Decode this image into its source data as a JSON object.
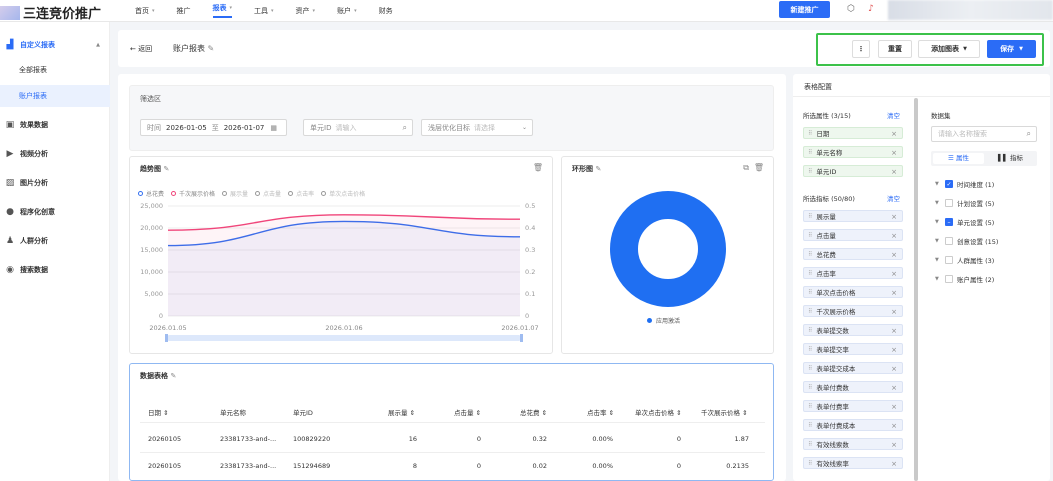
{
  "app": {
    "logo_text": "三连竞价推广"
  },
  "nav": {
    "items": [
      {
        "label": "首页",
        "caret": "▾"
      },
      {
        "label": "推广",
        "caret": ""
      },
      {
        "label": "报表",
        "caret": "▾"
      },
      {
        "label": "工具",
        "caret": "▾"
      },
      {
        "label": "资产",
        "caret": "▾"
      },
      {
        "label": "账户",
        "caret": "▾"
      },
      {
        "label": "财务",
        "caret": ""
      }
    ],
    "new_button": "新建推广"
  },
  "sidebar": {
    "group_custom": "自定义报表",
    "sub_items": [
      "全部报表",
      "账户报表"
    ],
    "items": [
      "效果数据",
      "视频分析",
      "图片分析",
      "程序化创意",
      "人群分析",
      "搜索数据"
    ]
  },
  "header": {
    "back_label": "← 返回",
    "title": "账户报表",
    "more": "⋮",
    "reset": "重置",
    "add_chart": "添加图表",
    "save": "保存"
  },
  "filter": {
    "title": "筛选区",
    "time_label": "时间",
    "date_start": "2026-01-05",
    "date_sep": "至",
    "date_end": "2026-01-07",
    "unit_id_label": "单元ID",
    "unit_id_placeholder": "请输入",
    "opt_target_label": "浅层优化目标",
    "opt_target_placeholder": "请选择"
  },
  "line_chart": {
    "title": "趋势图",
    "legend": [
      "总花费",
      "千次展示价格",
      "展示量",
      "点击量",
      "点击率",
      "单次点击价格"
    ],
    "y_left_ticks": [
      "25,000",
      "20,000",
      "15,000",
      "10,000",
      "5,000",
      "0"
    ],
    "y_right_ticks": [
      "0.5",
      "0.4",
      "0.3",
      "0.2",
      "0.1",
      "0"
    ],
    "x_ticks": [
      "2026.01.05",
      "2026.01.06",
      "2026.01.07"
    ],
    "colors": {
      "spend": "#3370f0",
      "cpm": "#f0457a"
    }
  },
  "chart_data": [
    {
      "type": "line",
      "title": "趋势图",
      "categories": [
        "2026.01.05",
        "2026.01.06",
        "2026.01.07"
      ],
      "series": [
        {
          "name": "总花费",
          "axis": "left",
          "values": [
            16000,
            21500,
            18000
          ]
        },
        {
          "name": "千次展示价格",
          "axis": "right",
          "values": [
            0.39,
            0.46,
            0.44
          ]
        }
      ],
      "ylim_left": [
        0,
        25000
      ],
      "ylim_right": [
        0,
        0.5
      ],
      "grid": true,
      "legend": "top-left"
    },
    {
      "type": "pie",
      "title": "环形图",
      "categories": [
        "应用激活"
      ],
      "values": [
        100
      ]
    }
  ],
  "donut_chart": {
    "title": "环形图",
    "legend_label": "应用激活",
    "color": "#1f6ff2"
  },
  "table": {
    "title": "数据表格",
    "headers": [
      "日期 ⇕",
      "单元名称",
      "单元ID",
      "展示量 ⇕",
      "点击量 ⇕",
      "总花费 ⇕",
      "点击率 ⇕",
      "单次点击价格 ⇕",
      "千次展示价格 ⇕"
    ],
    "rows": [
      [
        "20260105",
        "23381733-and-...",
        "100829220",
        "16",
        "0",
        "0.32",
        "0.00%",
        "0",
        "1.87"
      ],
      [
        "20260105",
        "23381733-and-...",
        "151294689",
        "8",
        "0",
        "0.02",
        "0.00%",
        "0",
        "0.2135"
      ]
    ]
  },
  "config_panel": {
    "title": "表格配置",
    "selected_attrs_label": "所选属性 (3/15)",
    "clear": "清空",
    "selected_attrs": [
      "日期",
      "单元名称",
      "单元ID"
    ],
    "selected_metrics_label": "所选指标 (50/80)",
    "selected_metrics": [
      "展示量",
      "点击量",
      "总花费",
      "点击率",
      "单次点击价格",
      "千次展示价格",
      "表单提交数",
      "表单提交率",
      "表单提交成本",
      "表单付费数",
      "表单付费率",
      "表单付费成本",
      "有效线索数",
      "有效线索率"
    ],
    "dataset_label": "数据集",
    "search_placeholder": "请输入名称搜索",
    "tab_attr": "属性",
    "tab_metric": "指标",
    "tree": [
      {
        "label": "时间维度 (1)",
        "state": "on"
      },
      {
        "label": "计划设置 (5)",
        "state": "off"
      },
      {
        "label": "单元设置 (5)",
        "state": "half"
      },
      {
        "label": "创意设置 (15)",
        "state": "off"
      },
      {
        "label": "人群属性 (3)",
        "state": "off"
      },
      {
        "label": "账户属性 (2)",
        "state": "off"
      }
    ]
  }
}
